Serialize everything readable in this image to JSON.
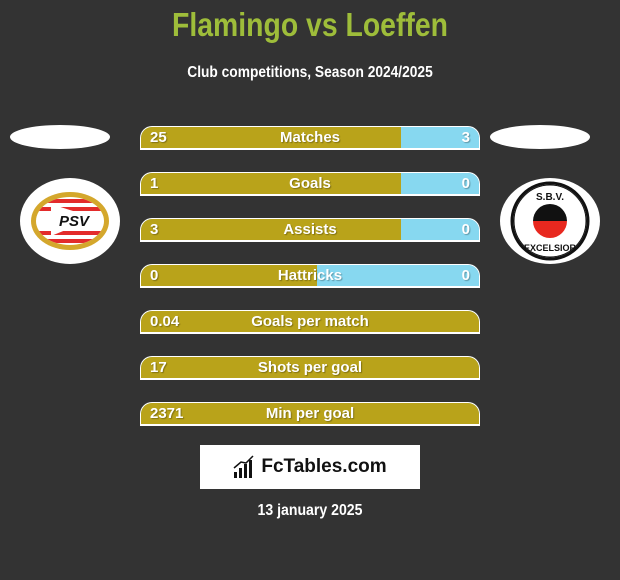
{
  "header": {
    "title": "Flamingo vs Loeffen",
    "subtitle": "Club competitions, Season 2024/2025"
  },
  "teams": {
    "left": {
      "logo": "psv-logo",
      "logo_text": "PSV"
    },
    "right": {
      "logo": "excelsior-logo",
      "logo_top_text": "S.B.V.",
      "logo_bottom_text": "EXCELSIOR"
    }
  },
  "colors": {
    "left_bar": "#b9a31a",
    "right_bar": "#87d8f0",
    "title": "#9ebd3a",
    "background": "#333333"
  },
  "stats": [
    {
      "label": "Matches",
      "left": "25",
      "right": "3",
      "left_share": 0.77
    },
    {
      "label": "Goals",
      "left": "1",
      "right": "0",
      "left_share": 0.77
    },
    {
      "label": "Assists",
      "left": "3",
      "right": "0",
      "left_share": 0.77
    },
    {
      "label": "Hattricks",
      "left": "0",
      "right": "0",
      "left_share": 0.52
    },
    {
      "label": "Goals per match",
      "left": "0.04",
      "right": "",
      "left_share": 1.0
    },
    {
      "label": "Shots per goal",
      "left": "17",
      "right": "",
      "left_share": 1.0
    },
    {
      "label": "Min per goal",
      "left": "2371",
      "right": "",
      "left_share": 1.0
    }
  ],
  "footer": {
    "brand": "FcTables.com",
    "date": "13 january 2025"
  }
}
